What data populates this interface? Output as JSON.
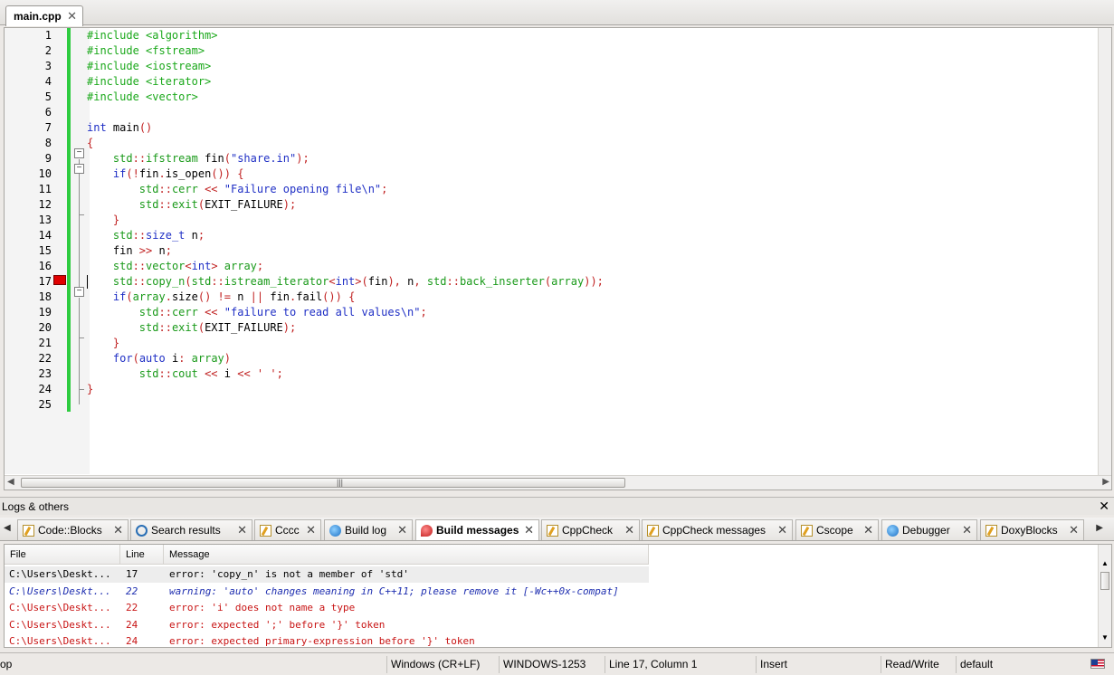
{
  "editor": {
    "tab_label": "main.cpp",
    "line_numbers": [
      "1",
      "2",
      "3",
      "4",
      "5",
      "6",
      "7",
      "8",
      "9",
      "10",
      "11",
      "12",
      "13",
      "14",
      "15",
      "16",
      "17",
      "18",
      "19",
      "20",
      "21",
      "22",
      "23",
      "24",
      "25"
    ],
    "code_lines": [
      [
        [
          "pp",
          "#include <algorithm>"
        ]
      ],
      [
        [
          "pp",
          "#include <fstream>"
        ]
      ],
      [
        [
          "pp",
          "#include <iostream>"
        ]
      ],
      [
        [
          "pp",
          "#include <iterator>"
        ]
      ],
      [
        [
          "pp",
          "#include <vector>"
        ]
      ],
      [],
      [
        [
          "kw",
          "int"
        ],
        [
          "id",
          " main"
        ],
        [
          "sym",
          "()"
        ]
      ],
      [
        [
          "sym",
          "{"
        ]
      ],
      [
        [
          "id",
          "    "
        ],
        [
          "ns",
          "std"
        ],
        [
          "sym",
          "::"
        ],
        [
          "ns",
          "ifstream"
        ],
        [
          "id",
          " fin"
        ],
        [
          "sym",
          "("
        ],
        [
          "str",
          "\"share.in\""
        ],
        [
          "sym",
          ");"
        ]
      ],
      [
        [
          "id",
          "    "
        ],
        [
          "kw",
          "if"
        ],
        [
          "sym",
          "(!"
        ],
        [
          "id",
          "fin"
        ],
        [
          "sym",
          "."
        ],
        [
          "id",
          "is_open"
        ],
        [
          "sym",
          "()) {"
        ]
      ],
      [
        [
          "id",
          "        "
        ],
        [
          "ns",
          "std"
        ],
        [
          "sym",
          "::"
        ],
        [
          "ns",
          "cerr"
        ],
        [
          "id",
          " "
        ],
        [
          "sym",
          "<<"
        ],
        [
          "id",
          " "
        ],
        [
          "str",
          "\"Failure opening file\\n\""
        ],
        [
          "sym",
          ";"
        ]
      ],
      [
        [
          "id",
          "        "
        ],
        [
          "ns",
          "std"
        ],
        [
          "sym",
          "::"
        ],
        [
          "ns",
          "exit"
        ],
        [
          "sym",
          "("
        ],
        [
          "id",
          "EXIT_FAILURE"
        ],
        [
          "sym",
          ");"
        ]
      ],
      [
        [
          "id",
          "    "
        ],
        [
          "sym",
          "}"
        ]
      ],
      [
        [
          "id",
          "    "
        ],
        [
          "ns",
          "std"
        ],
        [
          "sym",
          "::"
        ],
        [
          "kw",
          "size_t"
        ],
        [
          "id",
          " n"
        ],
        [
          "sym",
          ";"
        ]
      ],
      [
        [
          "id",
          "    fin "
        ],
        [
          "sym",
          ">>"
        ],
        [
          "id",
          " n"
        ],
        [
          "sym",
          ";"
        ]
      ],
      [
        [
          "id",
          "    "
        ],
        [
          "ns",
          "std"
        ],
        [
          "sym",
          "::"
        ],
        [
          "ns",
          "vector"
        ],
        [
          "sym",
          "<"
        ],
        [
          "kw",
          "int"
        ],
        [
          "sym",
          "> "
        ],
        [
          "ns",
          "array"
        ],
        [
          "sym",
          ";"
        ]
      ],
      [
        [
          "id",
          "    "
        ],
        [
          "ns",
          "std"
        ],
        [
          "sym",
          "::"
        ],
        [
          "ns",
          "copy_n"
        ],
        [
          "sym",
          "("
        ],
        [
          "ns",
          "std"
        ],
        [
          "sym",
          "::"
        ],
        [
          "ns",
          "istream_iterator"
        ],
        [
          "sym",
          "<"
        ],
        [
          "kw",
          "int"
        ],
        [
          "sym",
          ">("
        ],
        [
          "id",
          "fin"
        ],
        [
          "sym",
          "), "
        ],
        [
          "id",
          "n"
        ],
        [
          "sym",
          ", "
        ],
        [
          "ns",
          "std"
        ],
        [
          "sym",
          "::"
        ],
        [
          "ns",
          "back_inserter"
        ],
        [
          "sym",
          "("
        ],
        [
          "ns",
          "array"
        ],
        [
          "sym",
          "));"
        ]
      ],
      [
        [
          "id",
          "    "
        ],
        [
          "kw",
          "if"
        ],
        [
          "sym",
          "("
        ],
        [
          "ns",
          "array"
        ],
        [
          "sym",
          "."
        ],
        [
          "id",
          "size"
        ],
        [
          "sym",
          "() != "
        ],
        [
          "id",
          "n "
        ],
        [
          "sym",
          "||"
        ],
        [
          "id",
          " fin"
        ],
        [
          "sym",
          "."
        ],
        [
          "id",
          "fail"
        ],
        [
          "sym",
          "()) {"
        ]
      ],
      [
        [
          "id",
          "        "
        ],
        [
          "ns",
          "std"
        ],
        [
          "sym",
          "::"
        ],
        [
          "ns",
          "cerr"
        ],
        [
          "id",
          " "
        ],
        [
          "sym",
          "<<"
        ],
        [
          "id",
          " "
        ],
        [
          "str",
          "\"failure to read all values\\n\""
        ],
        [
          "sym",
          ";"
        ]
      ],
      [
        [
          "id",
          "        "
        ],
        [
          "ns",
          "std"
        ],
        [
          "sym",
          "::"
        ],
        [
          "ns",
          "exit"
        ],
        [
          "sym",
          "("
        ],
        [
          "id",
          "EXIT_FAILURE"
        ],
        [
          "sym",
          ");"
        ]
      ],
      [
        [
          "id",
          "    "
        ],
        [
          "sym",
          "}"
        ]
      ],
      [
        [
          "id",
          "    "
        ],
        [
          "kw",
          "for"
        ],
        [
          "sym",
          "("
        ],
        [
          "kw",
          "auto"
        ],
        [
          "id",
          " i"
        ],
        [
          "sym",
          ": "
        ],
        [
          "ns",
          "array"
        ],
        [
          "sym",
          ")"
        ]
      ],
      [
        [
          "id",
          "        "
        ],
        [
          "ns",
          "std"
        ],
        [
          "sym",
          "::"
        ],
        [
          "ns",
          "cout"
        ],
        [
          "id",
          " "
        ],
        [
          "sym",
          "<<"
        ],
        [
          "id",
          " i "
        ],
        [
          "sym",
          "<<"
        ],
        [
          "id",
          " "
        ],
        [
          "sym",
          "' ';"
        ]
      ],
      [
        [
          "sym",
          "}"
        ]
      ],
      []
    ]
  },
  "logs": {
    "title": "Logs & others",
    "tabs": [
      {
        "label": "Code::Blocks",
        "icon": "page"
      },
      {
        "label": "Search results",
        "icon": "search"
      },
      {
        "label": "Cccc",
        "icon": "page"
      },
      {
        "label": "Build log",
        "icon": "blue"
      },
      {
        "label": "Build messages",
        "icon": "pin",
        "active": true
      },
      {
        "label": "CppCheck",
        "icon": "page"
      },
      {
        "label": "CppCheck messages",
        "icon": "page"
      },
      {
        "label": "Cscope",
        "icon": "page"
      },
      {
        "label": "Debugger",
        "icon": "blue"
      },
      {
        "label": "DoxyBlocks",
        "icon": "page"
      }
    ],
    "columns": [
      "File",
      "Line",
      "Message"
    ],
    "rows": [
      {
        "file": "C:\\Users\\Deskt...",
        "line": "17",
        "message": "error: 'copy_n' is not a member of 'std'",
        "kind": "selected"
      },
      {
        "file": "C:\\Users\\Deskt...",
        "line": "22",
        "message": "warning: 'auto' changes meaning in C++11; please remove it [-Wc++0x-compat]",
        "kind": "warn"
      },
      {
        "file": "C:\\Users\\Deskt...",
        "line": "22",
        "message": "error: 'i' does not name a type",
        "kind": "err"
      },
      {
        "file": "C:\\Users\\Deskt...",
        "line": "24",
        "message": "error: expected ';' before '}' token",
        "kind": "err"
      },
      {
        "file": "C:\\Users\\Deskt...",
        "line": "24",
        "message": "error: expected primary-expression before '}' token",
        "kind": "err"
      }
    ]
  },
  "status": {
    "left": "op",
    "eol": "Windows (CR+LF)",
    "encoding": "WINDOWS-1253",
    "position": "Line 17, Column 1",
    "mode": "Insert",
    "access": "Read/Write",
    "profile": "default"
  },
  "colors": {
    "preprocessor": "#1aa81a",
    "keyword": "#1f2fc5",
    "error": "#c81414",
    "change_bar": "#2ecc40",
    "breakpoint": "#e00000"
  }
}
